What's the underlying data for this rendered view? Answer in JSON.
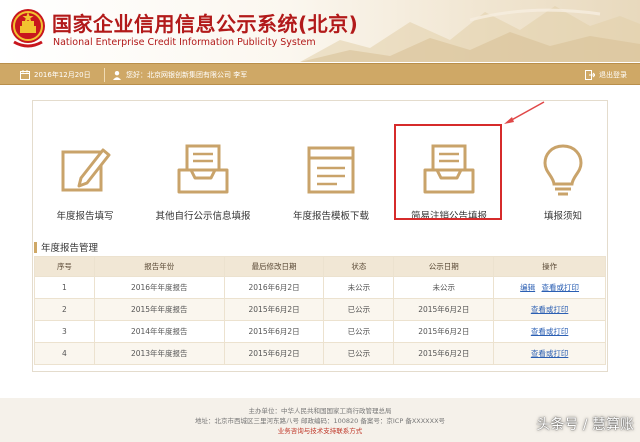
{
  "header": {
    "title_cn": "国家企业信用信息公示系统(北京)",
    "title_en": "National Enterprise Credit Information Publicity System"
  },
  "infobar": {
    "date": "2016年12月20日",
    "user": "您好：北京网银创新集团有限公司 李军",
    "logout": "退出登录"
  },
  "functions": [
    {
      "label": "年度报告填写",
      "icon": "pencil-edit-icon"
    },
    {
      "label": "其他自行公示信息填报",
      "icon": "inbox-tray-icon"
    },
    {
      "label": "年度报告模板下载",
      "icon": "document-window-icon"
    },
    {
      "label": "简易注销公告填报",
      "icon": "inbox-tray-icon"
    },
    {
      "label": "填报须知",
      "icon": "lightbulb-icon"
    }
  ],
  "section": {
    "title": "年度报告管理"
  },
  "table": {
    "headers": [
      "序号",
      "报告年份",
      "最后修改日期",
      "状态",
      "公示日期",
      "操作"
    ],
    "rows": [
      {
        "no": "1",
        "year": "2016年年度报告",
        "modified": "2016年6月2日",
        "status": "未公示",
        "public_date": "未公示",
        "actions": [
          "编辑",
          "查看或打印"
        ]
      },
      {
        "no": "2",
        "year": "2015年年度报告",
        "modified": "2015年6月2日",
        "status": "已公示",
        "public_date": "2015年6月2日",
        "actions": [
          "查看或打印"
        ]
      },
      {
        "no": "3",
        "year": "2014年年度报告",
        "modified": "2015年6月2日",
        "status": "已公示",
        "public_date": "2015年6月2日",
        "actions": [
          "查看或打印"
        ]
      },
      {
        "no": "4",
        "year": "2013年年度报告",
        "modified": "2015年6月2日",
        "status": "已公示",
        "public_date": "2015年6月2日",
        "actions": [
          "查看或打印"
        ]
      }
    ]
  },
  "footer": {
    "line1": "主办单位：中华人民共和国国家工商行政管理总局",
    "line2": "地址：北京市西城区三里河东路八号   邮政编码：100820   备案号：京ICP 备XXXXXX号",
    "line3": "业务咨询与技术支持联系方式"
  },
  "watermark": "头条号 / 慧算账",
  "colors": {
    "brand_red": "#b21a1a",
    "gold_bar": "#cfa866",
    "highlight_red": "#d62b2b",
    "link_blue": "#2b5fb3"
  }
}
